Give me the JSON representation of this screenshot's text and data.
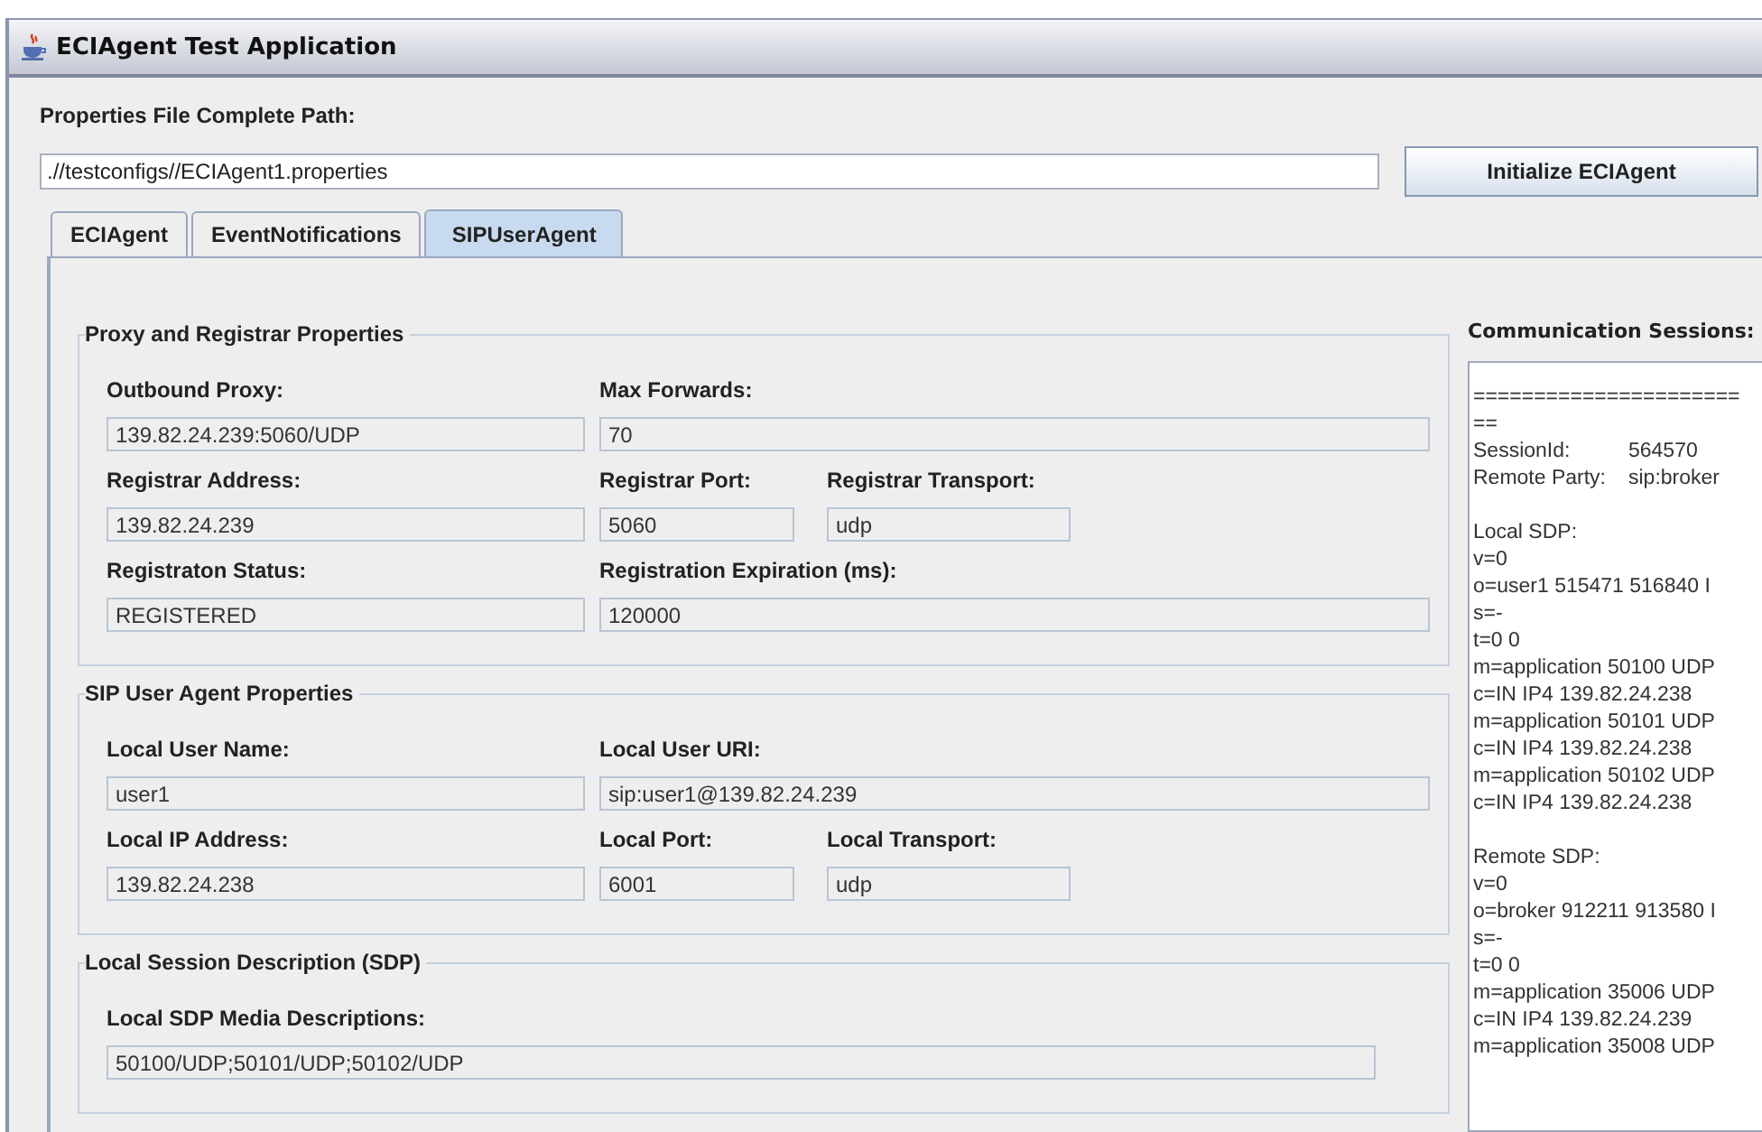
{
  "window": {
    "title": "ECIAgent Test Application"
  },
  "properties_path": {
    "label": "Properties File Complete Path:",
    "value": ".//testconfigs//ECIAgent1.properties"
  },
  "initialize_button": "Initialize ECIAgent",
  "tabs": [
    {
      "label": "ECIAgent",
      "selected": false
    },
    {
      "label": "EventNotifications",
      "selected": false
    },
    {
      "label": "SIPUserAgent",
      "selected": true
    }
  ],
  "groups": [
    {
      "title": "Proxy and Registrar Properties",
      "rows": [
        [
          {
            "label": "Outbound Proxy:",
            "value": "139.82.24.239:5060/UDP",
            "kind": "wide"
          },
          {
            "label": "Max Forwards:",
            "value": "70",
            "kind": "rest"
          }
        ],
        [
          {
            "label": "Registrar Address:",
            "value": "139.82.24.239",
            "kind": "wide"
          },
          {
            "label": "Registrar Port:",
            "value": "5060",
            "kind": "small"
          },
          {
            "label": "Registrar Transport:",
            "value": "udp",
            "kind": "medium"
          }
        ],
        [
          {
            "label": "Registraton Status:",
            "value": "REGISTERED",
            "kind": "wide"
          },
          {
            "label": "Registration Expiration (ms):",
            "value": "120000",
            "kind": "rest"
          }
        ]
      ]
    },
    {
      "title": "SIP User Agent Properties",
      "rows": [
        [
          {
            "label": "Local User Name:",
            "value": "user1",
            "kind": "wide"
          },
          {
            "label": "Local User URI:",
            "value": "sip:user1@139.82.24.239",
            "kind": "rest"
          }
        ],
        [
          {
            "label": "Local IP Address:",
            "value": "139.82.24.238",
            "kind": "wide"
          },
          {
            "label": "Local Port:",
            "value": "6001",
            "kind": "small"
          },
          {
            "label": "Local Transport:",
            "value": "udp",
            "kind": "medium"
          }
        ]
      ]
    },
    {
      "title": "Local Session Description (SDP)",
      "rows": [
        [
          {
            "label": "Local SDP Media Descriptions:",
            "value": "50100/UDP;50101/UDP;50102/UDP",
            "kind": "full"
          }
        ]
      ]
    }
  ],
  "sessions": {
    "label": "Communication Sessions:",
    "blocks": [
      [
        {
          "text": "======================"
        },
        {
          "text": "=="
        },
        {
          "label": "SessionId:",
          "value": "564570"
        },
        {
          "label": "Remote Party:",
          "value": "sip:broker"
        }
      ],
      [
        {
          "text": "Local SDP:"
        },
        {
          "text": "v=0"
        },
        {
          "text": "o=user1 515471 516840 I"
        },
        {
          "text": "s=-"
        },
        {
          "text": "t=0 0"
        },
        {
          "text": "m=application 50100 UDP"
        },
        {
          "text": "c=IN IP4 139.82.24.238"
        },
        {
          "text": "m=application 50101 UDP"
        },
        {
          "text": "c=IN IP4 139.82.24.238"
        },
        {
          "text": "m=application 50102 UDP"
        },
        {
          "text": "c=IN IP4 139.82.24.238"
        }
      ],
      [
        {
          "text": "Remote SDP:"
        },
        {
          "text": "v=0"
        },
        {
          "text": "o=broker 912211 913580 I"
        },
        {
          "text": "s=-"
        },
        {
          "text": "t=0 0"
        },
        {
          "text": "m=application 35006 UDP"
        },
        {
          "text": "c=IN IP4 139.82.24.239"
        },
        {
          "text": "m=application 35008 UDP"
        }
      ]
    ]
  }
}
